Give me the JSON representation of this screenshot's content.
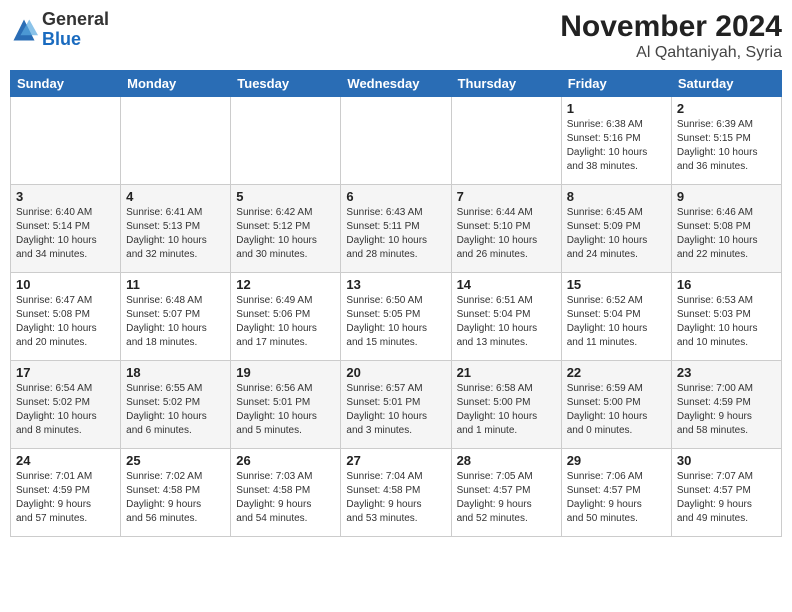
{
  "header": {
    "logo_general": "General",
    "logo_blue": "Blue",
    "month": "November 2024",
    "location": "Al Qahtaniyah, Syria"
  },
  "days_of_week": [
    "Sunday",
    "Monday",
    "Tuesday",
    "Wednesday",
    "Thursday",
    "Friday",
    "Saturday"
  ],
  "weeks": [
    [
      {
        "day": "",
        "info": ""
      },
      {
        "day": "",
        "info": ""
      },
      {
        "day": "",
        "info": ""
      },
      {
        "day": "",
        "info": ""
      },
      {
        "day": "",
        "info": ""
      },
      {
        "day": "1",
        "info": "Sunrise: 6:38 AM\nSunset: 5:16 PM\nDaylight: 10 hours\nand 38 minutes."
      },
      {
        "day": "2",
        "info": "Sunrise: 6:39 AM\nSunset: 5:15 PM\nDaylight: 10 hours\nand 36 minutes."
      }
    ],
    [
      {
        "day": "3",
        "info": "Sunrise: 6:40 AM\nSunset: 5:14 PM\nDaylight: 10 hours\nand 34 minutes."
      },
      {
        "day": "4",
        "info": "Sunrise: 6:41 AM\nSunset: 5:13 PM\nDaylight: 10 hours\nand 32 minutes."
      },
      {
        "day": "5",
        "info": "Sunrise: 6:42 AM\nSunset: 5:12 PM\nDaylight: 10 hours\nand 30 minutes."
      },
      {
        "day": "6",
        "info": "Sunrise: 6:43 AM\nSunset: 5:11 PM\nDaylight: 10 hours\nand 28 minutes."
      },
      {
        "day": "7",
        "info": "Sunrise: 6:44 AM\nSunset: 5:10 PM\nDaylight: 10 hours\nand 26 minutes."
      },
      {
        "day": "8",
        "info": "Sunrise: 6:45 AM\nSunset: 5:09 PM\nDaylight: 10 hours\nand 24 minutes."
      },
      {
        "day": "9",
        "info": "Sunrise: 6:46 AM\nSunset: 5:08 PM\nDaylight: 10 hours\nand 22 minutes."
      }
    ],
    [
      {
        "day": "10",
        "info": "Sunrise: 6:47 AM\nSunset: 5:08 PM\nDaylight: 10 hours\nand 20 minutes."
      },
      {
        "day": "11",
        "info": "Sunrise: 6:48 AM\nSunset: 5:07 PM\nDaylight: 10 hours\nand 18 minutes."
      },
      {
        "day": "12",
        "info": "Sunrise: 6:49 AM\nSunset: 5:06 PM\nDaylight: 10 hours\nand 17 minutes."
      },
      {
        "day": "13",
        "info": "Sunrise: 6:50 AM\nSunset: 5:05 PM\nDaylight: 10 hours\nand 15 minutes."
      },
      {
        "day": "14",
        "info": "Sunrise: 6:51 AM\nSunset: 5:04 PM\nDaylight: 10 hours\nand 13 minutes."
      },
      {
        "day": "15",
        "info": "Sunrise: 6:52 AM\nSunset: 5:04 PM\nDaylight: 10 hours\nand 11 minutes."
      },
      {
        "day": "16",
        "info": "Sunrise: 6:53 AM\nSunset: 5:03 PM\nDaylight: 10 hours\nand 10 minutes."
      }
    ],
    [
      {
        "day": "17",
        "info": "Sunrise: 6:54 AM\nSunset: 5:02 PM\nDaylight: 10 hours\nand 8 minutes."
      },
      {
        "day": "18",
        "info": "Sunrise: 6:55 AM\nSunset: 5:02 PM\nDaylight: 10 hours\nand 6 minutes."
      },
      {
        "day": "19",
        "info": "Sunrise: 6:56 AM\nSunset: 5:01 PM\nDaylight: 10 hours\nand 5 minutes."
      },
      {
        "day": "20",
        "info": "Sunrise: 6:57 AM\nSunset: 5:01 PM\nDaylight: 10 hours\nand 3 minutes."
      },
      {
        "day": "21",
        "info": "Sunrise: 6:58 AM\nSunset: 5:00 PM\nDaylight: 10 hours\nand 1 minute."
      },
      {
        "day": "22",
        "info": "Sunrise: 6:59 AM\nSunset: 5:00 PM\nDaylight: 10 hours\nand 0 minutes."
      },
      {
        "day": "23",
        "info": "Sunrise: 7:00 AM\nSunset: 4:59 PM\nDaylight: 9 hours\nand 58 minutes."
      }
    ],
    [
      {
        "day": "24",
        "info": "Sunrise: 7:01 AM\nSunset: 4:59 PM\nDaylight: 9 hours\nand 57 minutes."
      },
      {
        "day": "25",
        "info": "Sunrise: 7:02 AM\nSunset: 4:58 PM\nDaylight: 9 hours\nand 56 minutes."
      },
      {
        "day": "26",
        "info": "Sunrise: 7:03 AM\nSunset: 4:58 PM\nDaylight: 9 hours\nand 54 minutes."
      },
      {
        "day": "27",
        "info": "Sunrise: 7:04 AM\nSunset: 4:58 PM\nDaylight: 9 hours\nand 53 minutes."
      },
      {
        "day": "28",
        "info": "Sunrise: 7:05 AM\nSunset: 4:57 PM\nDaylight: 9 hours\nand 52 minutes."
      },
      {
        "day": "29",
        "info": "Sunrise: 7:06 AM\nSunset: 4:57 PM\nDaylight: 9 hours\nand 50 minutes."
      },
      {
        "day": "30",
        "info": "Sunrise: 7:07 AM\nSunset: 4:57 PM\nDaylight: 9 hours\nand 49 minutes."
      }
    ]
  ]
}
